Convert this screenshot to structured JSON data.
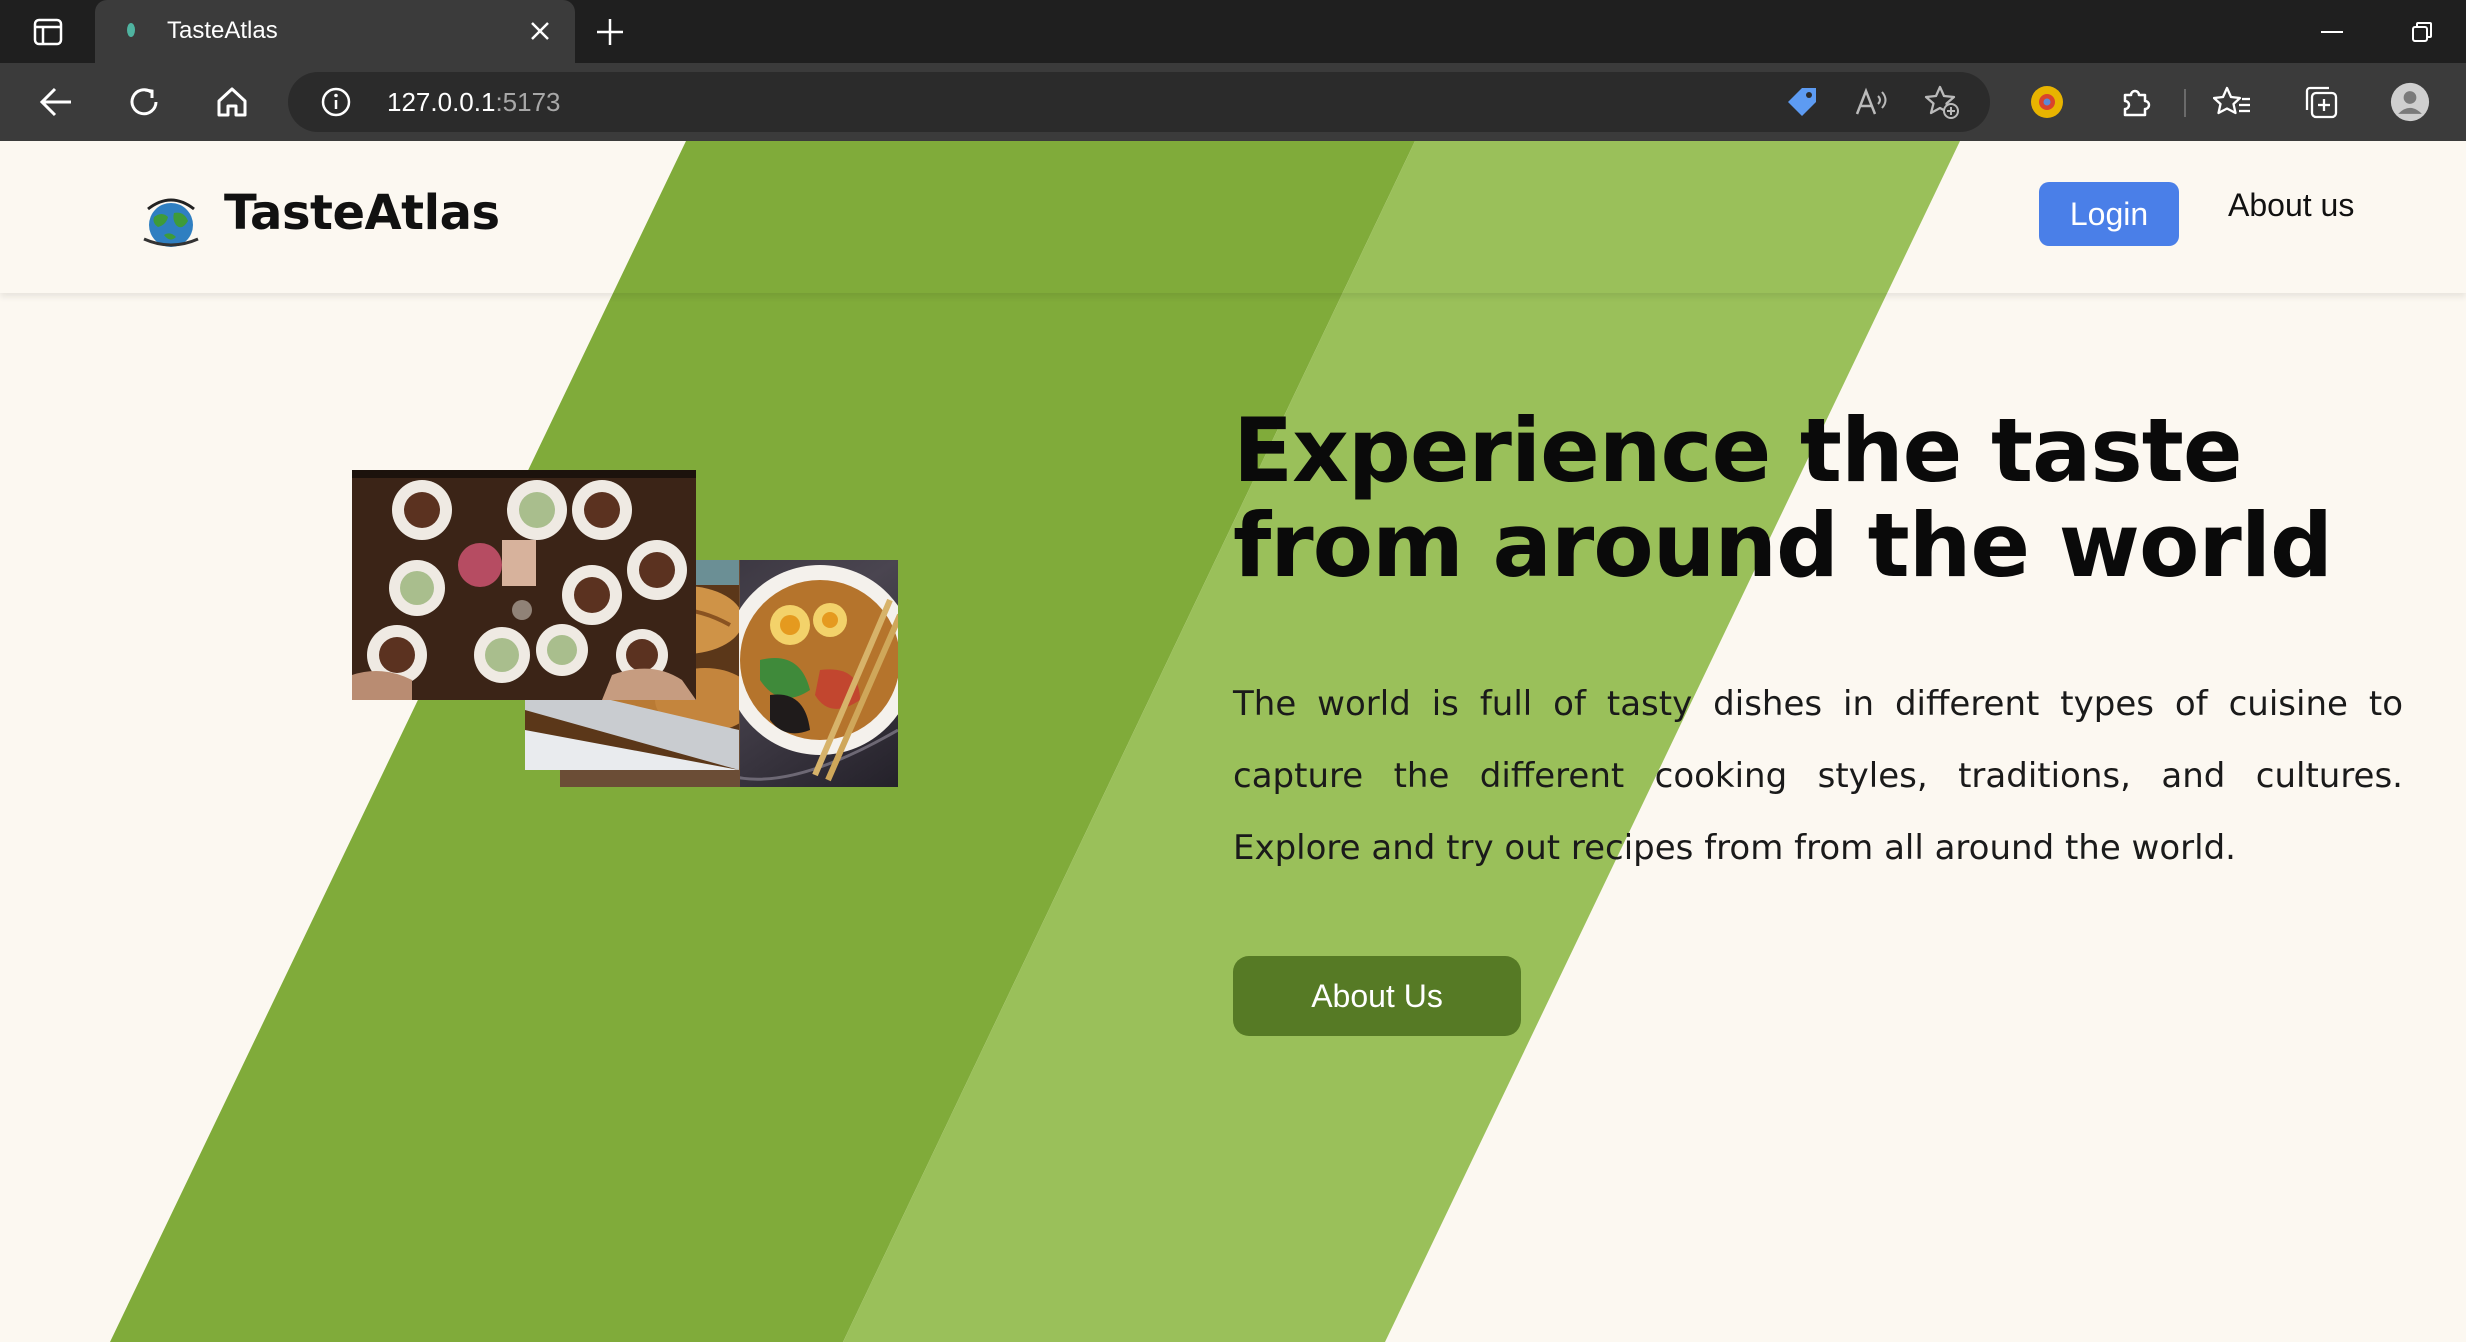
{
  "browser": {
    "tab_title": "TasteAtlas",
    "url_host": "127.0.0.1",
    "url_port": ":5173"
  },
  "site": {
    "brand": "TasteAtlas",
    "nav": {
      "login": "Login",
      "about": "About us"
    }
  },
  "hero": {
    "title": "Experience the taste from around the world",
    "description": "The world is full of tasty dishes in different types of cuisine to capture the different cooking styles, traditions, and cultures. Explore and try out recipes from from all around the world.",
    "cta": "About Us"
  },
  "colors": {
    "page_background": "#fcf8f1",
    "stripe_dark": "#80ab3a",
    "stripe_light": "#9ac05a",
    "login_button": "#4a7fe8",
    "cta_button": "#567a25"
  },
  "icons": {
    "sidebar": "sidebar-icon",
    "close": "close-icon",
    "new_tab": "plus-icon",
    "back": "back-arrow-icon",
    "refresh": "refresh-icon",
    "home": "home-icon",
    "info": "info-icon",
    "tag": "tag-icon",
    "read_aloud": "read-aloud-icon",
    "add_favorite": "add-favorite-icon",
    "extension": "puzzle-icon",
    "favorites": "favorites-icon",
    "collections": "collections-icon",
    "profile": "profile-icon"
  }
}
